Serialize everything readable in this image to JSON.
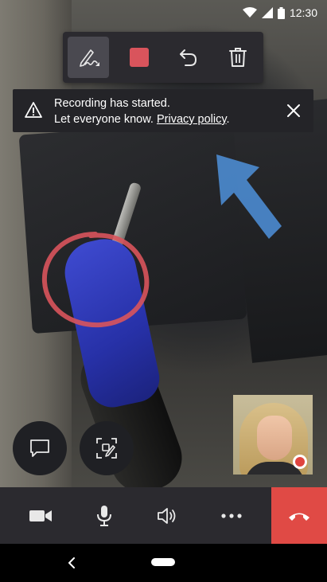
{
  "status_bar": {
    "time": "12:30",
    "icons": [
      "wifi-icon",
      "signal-icon",
      "battery-icon"
    ]
  },
  "annotation_toolbar": {
    "tools": [
      {
        "name": "pen-tool",
        "icon": "pen-icon",
        "selected": true
      },
      {
        "name": "color-tool",
        "icon": "color-swatch",
        "color": "#d9545c"
      },
      {
        "name": "undo-tool",
        "icon": "undo-icon"
      },
      {
        "name": "delete-tool",
        "icon": "trash-icon"
      }
    ]
  },
  "recording_banner": {
    "line1": "Recording has started.",
    "line2": "Let everyone know.",
    "link": "Privacy policy",
    "trailing": "."
  },
  "annotations": {
    "circle_color": "#d9545c",
    "arrow_color": "#4a86c8"
  },
  "floating_buttons": [
    {
      "name": "chat-button",
      "icon": "chat-icon"
    },
    {
      "name": "snapshot-button",
      "icon": "snapshot-edit-icon"
    }
  ],
  "self_view": {
    "recording": true,
    "record_color": "#e0443f"
  },
  "call_controls": [
    {
      "name": "camera-button",
      "icon": "video-camera-icon"
    },
    {
      "name": "microphone-button",
      "icon": "microphone-icon"
    },
    {
      "name": "speaker-button",
      "icon": "speaker-icon"
    },
    {
      "name": "more-button",
      "icon": "more-icon"
    },
    {
      "name": "end-call-button",
      "icon": "hang-up-icon",
      "color": "#e04a45"
    }
  ],
  "nav_bar": {
    "icons": [
      "back-icon",
      "home-pill"
    ]
  }
}
